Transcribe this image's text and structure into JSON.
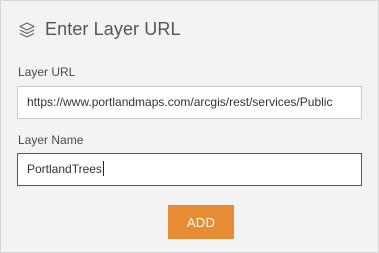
{
  "header": {
    "title": "Enter Layer URL",
    "icon": "layers-icon"
  },
  "form": {
    "url_label": "Layer URL",
    "url_value": "https://www.portlandmaps.com/arcgis/rest/services/Public",
    "name_label": "Layer Name",
    "name_value": "PortlandTrees"
  },
  "actions": {
    "add_label": "ADD"
  },
  "colors": {
    "accent": "#e88c34",
    "focus_border": "#2f5f8a",
    "panel_bg": "#f3f3f3"
  }
}
